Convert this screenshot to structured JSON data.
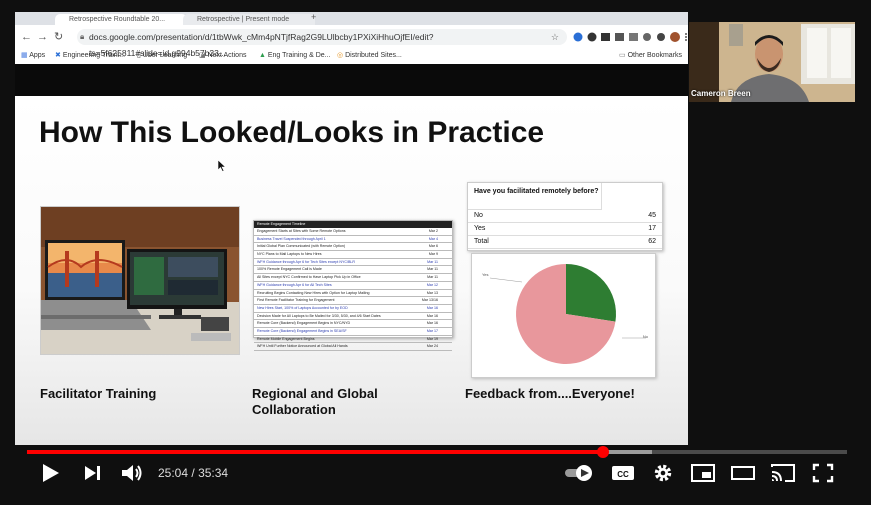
{
  "browser": {
    "tabs": [
      "Retrospective Roundtable 20...",
      "Retrospective | Present mode"
    ],
    "url": "docs.google.com/presentation/d/1tbWwk_cMm4pNTjfRag2G9LUlbcby1PXiXiHhuOjfEI/edit?ts=5f625811#slide=id.g994b57b23...",
    "bookmarks": [
      "Apps",
      "Engineering Traini...",
      "Uber Learning",
      "Next Actions",
      "Eng Training & De...",
      "Distributed Sites..."
    ],
    "other_bookmarks": "Other Bookmarks"
  },
  "slide": {
    "title": "How This Looked/Looks in Practice",
    "captions": [
      "Facilitator Training",
      "Regional and Global Collaboration",
      "Feedback from....Everyone!"
    ],
    "timeline": {
      "header": "Remote Engagement Timeline",
      "rows": [
        {
          "event": "Engagement Starts at Sites with Some Remote Options",
          "date": "Mar 2"
        },
        {
          "event": "Business Travel Suspended through April 1",
          "date": "Mar 4"
        },
        {
          "event": "Initial Global Plan Communicated (with Remote Option)",
          "date": "Mar 6"
        },
        {
          "event": "NYC Plans to Mail Laptops to New Hires",
          "date": "Mar 9"
        },
        {
          "event": "WFH Guidance through Apr 6 for Tech Sites except NYC/BLR",
          "date": "Mar 11"
        },
        {
          "event": "100% Remote Engagement Call is Made",
          "date": "Mar 11"
        },
        {
          "event": "All Sites except NYC Confirmed to Have Laptop Pick Up in Office",
          "date": "Mar 11"
        },
        {
          "event": "WFH Guidance through Apr 6 for All Tech Sites",
          "date": "Mar 12"
        },
        {
          "event": "Recruiting Begins Contacting New Hires with Option for Laptop Mailing",
          "date": "Mar 13"
        },
        {
          "event": "First Remote Facilitator Training for Engagement",
          "date": "Mar 13/16"
        },
        {
          "event": "New Hires Start, 100% of Laptops Accounted for by EOD",
          "date": "Mar 16"
        },
        {
          "event": "Decision Made for All Laptops to Be Mailed for 3/30, 5/30, and 4/6 Start Dates",
          "date": "Mar 16"
        },
        {
          "event": "Remote Core (Backend) Engagement Begins in NYC/NYD",
          "date": "Mar 16"
        },
        {
          "event": "Remote Core (Backend) Engagement Begins in SEA/SF",
          "date": "Mar 17"
        },
        {
          "event": "Remote Mobile Engagement Begins",
          "date": "Mar 19"
        },
        {
          "event": "WFH Until Further Notice Announced at Global All Hands",
          "date": "Mar 24"
        }
      ]
    },
    "survey": {
      "question": "Have you facilitated remotely before?",
      "rows": [
        {
          "label": "No",
          "value": "45"
        },
        {
          "label": "Yes",
          "value": "17"
        },
        {
          "label": "Total",
          "value": "62"
        }
      ]
    },
    "pie": {
      "labels": [
        "Yes",
        "No"
      ],
      "values": [
        17,
        45
      ],
      "colors": [
        "#2e7d32",
        "#e8979c"
      ]
    }
  },
  "webcam": {
    "name": "Cameron Breen"
  },
  "player": {
    "current_time": "25:04",
    "separator": "/",
    "duration": "35:34",
    "progress_played": 0.703,
    "progress_loaded": 0.762
  }
}
